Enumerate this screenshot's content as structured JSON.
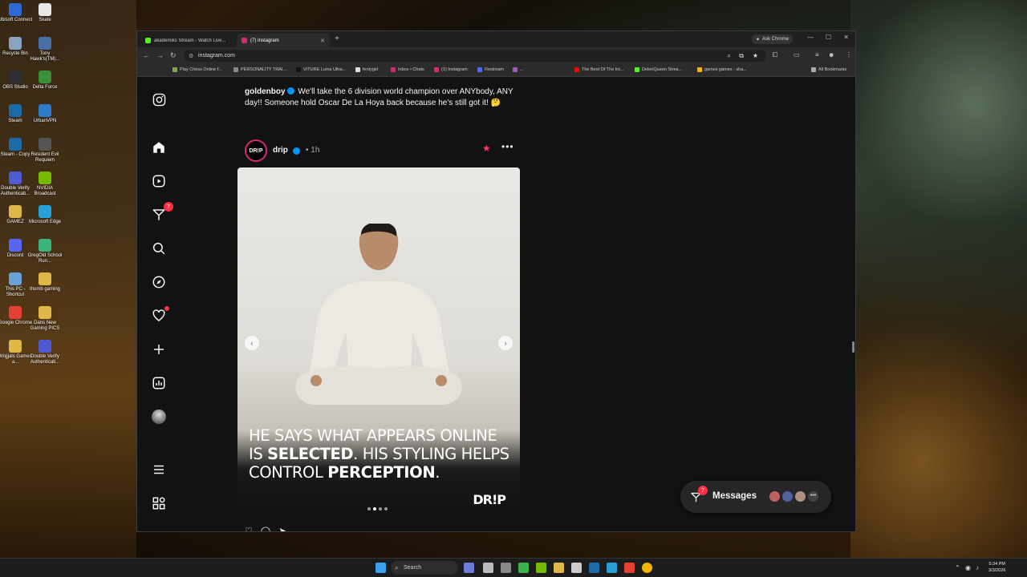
{
  "desktop": {
    "icons": [
      {
        "label": "Ubisoft Connect",
        "color": "#2d6ad6"
      },
      {
        "label": "Skate",
        "color": "#e8e8e8"
      },
      {
        "label": "Recycle Bin",
        "color": "#8aa3c2"
      },
      {
        "label": "Tony Hawk's(TM)...",
        "color": "#4a6fa5"
      },
      {
        "label": "OBS Studio",
        "color": "#302e31"
      },
      {
        "label": "Delta Force",
        "color": "#3b8f3b"
      },
      {
        "label": "Steam",
        "color": "#1b6aa5"
      },
      {
        "label": "UrbanVPN",
        "color": "#2f7ac7"
      },
      {
        "label": "Steam - Copy",
        "color": "#1b6aa5"
      },
      {
        "label": "Resident Evil Requiem",
        "color": "#555"
      },
      {
        "label": "Double Verify Authenticati...",
        "color": "#4e5bd1"
      },
      {
        "label": "NVIDIA Broadcast",
        "color": "#76b900"
      },
      {
        "label": "GAMEZ",
        "color": "#e0b84a"
      },
      {
        "label": "Microsoft Edge",
        "color": "#2a9fd6"
      },
      {
        "label": "Discord",
        "color": "#5865f2"
      },
      {
        "label": "GregOld School Run...",
        "color": "#3bb37a"
      },
      {
        "label": "This PC - Shortcut",
        "color": "#6aa0d8"
      },
      {
        "label": "thumb gaming",
        "color": "#e0b84a"
      },
      {
        "label": "Google Chrome",
        "color": "#e34133"
      },
      {
        "label": "Dans New Gaming PICS",
        "color": "#e0b84a"
      },
      {
        "label": "Wojjjals Games a...",
        "color": "#e0b84a"
      },
      {
        "label": "Double Verify Authenticati...",
        "color": "#4e5bd1"
      }
    ]
  },
  "browser": {
    "tabs": [
      {
        "label": "akademiks Stream - Watch Live...",
        "active": false,
        "color": "#53fc18"
      },
      {
        "label": "(7) Instagram",
        "active": true,
        "color": "#d62976"
      }
    ],
    "ask_chrome": "Ask Chrome",
    "url": "instagram.com",
    "bookmarks": [
      {
        "label": "Play Chess Online f...",
        "color": "#7fa650"
      },
      {
        "label": "PERSONALITY TRAI...",
        "color": "#888"
      },
      {
        "label": "VITURE Luma Ultra...",
        "color": "#111"
      },
      {
        "label": "fentygirl",
        "color": "#ddd"
      },
      {
        "label": "Inbox • Chats",
        "color": "#d62976"
      },
      {
        "label": "(1) Instagram",
        "color": "#d62976"
      },
      {
        "label": "Restream",
        "color": "#4a6cf7"
      },
      {
        "label": "...",
        "color": "#9b59b6"
      },
      {
        "label": "The Best Of The Int...",
        "color": "#ff0000"
      },
      {
        "label": "DelenQueen Strea...",
        "color": "#53fc18"
      },
      {
        "label": "games games - sha...",
        "color": "#f4b400"
      },
      {
        "label": "All Bookmarks",
        "color": "#aaa"
      }
    ]
  },
  "instagram": {
    "notifications_badge": "7",
    "caption": {
      "username": "goldenboy",
      "text": "We'll take the 6 division world champion over ANYbody, ANY day!! Someone hold Oscar De La Hoya back because he's still got it! 🤔"
    },
    "post": {
      "avatar_text": "DR!P",
      "username": "drip",
      "time": "• 1h",
      "overlay_line1_a": "HE SAYS WHAT APPEARS ONLINE",
      "overlay_line2_a": "IS ",
      "overlay_line2_b": "SELECTED",
      "overlay_line2_c": ". HIS STYLING HELPS",
      "overlay_line3_a": "CONTROL ",
      "overlay_line3_b": "PERCEPTION",
      "overlay_line3_c": ".",
      "logo": "DR!P",
      "carousel_count": 4,
      "carousel_index": 2
    },
    "messages": {
      "label": "Messages",
      "badge": "7"
    }
  },
  "taskbar": {
    "search": "Search",
    "time": "5:34 PM",
    "date": "3/3/2026"
  }
}
